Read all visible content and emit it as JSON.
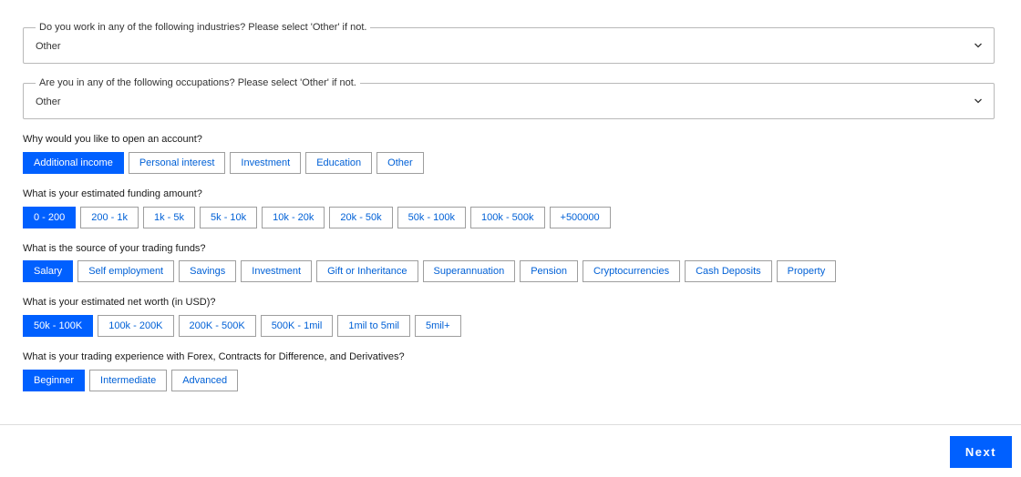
{
  "industry": {
    "legend": "Do you work in any of the following industries? Please select 'Other' if not.",
    "value": "Other"
  },
  "occupation": {
    "legend": "Are you in any of the following occupations? Please select 'Other' if not.",
    "value": "Other"
  },
  "questions": [
    {
      "label": "Why would you like to open an account?",
      "options": [
        "Additional income",
        "Personal interest",
        "Investment",
        "Education",
        "Other"
      ],
      "selected": "Additional income"
    },
    {
      "label": "What is your estimated funding amount?",
      "options": [
        "0 - 200",
        "200 - 1k",
        "1k - 5k",
        "5k - 10k",
        "10k - 20k",
        "20k - 50k",
        "50k - 100k",
        "100k - 500k",
        "+500000"
      ],
      "selected": "0 - 200"
    },
    {
      "label": "What is the source of your trading funds?",
      "options": [
        "Salary",
        "Self employment",
        "Savings",
        "Investment",
        "Gift or Inheritance",
        "Superannuation",
        "Pension",
        "Cryptocurrencies",
        "Cash Deposits",
        "Property"
      ],
      "selected": "Salary"
    },
    {
      "label": "What is your estimated net worth (in USD)?",
      "options": [
        "50k - 100K",
        "100k - 200K",
        "200K - 500K",
        "500K - 1mil",
        "1mil to 5mil",
        "5mil+"
      ],
      "selected": "50k - 100K"
    },
    {
      "label": "What is your trading experience with Forex, Contracts for Difference, and Derivatives?",
      "options": [
        "Beginner",
        "Intermediate",
        "Advanced"
      ],
      "selected": "Beginner"
    }
  ],
  "footer": {
    "next_label": "Next"
  },
  "colors": {
    "accent": "#0060ff",
    "option_text": "#0060d6",
    "border": "#9e9e9e"
  }
}
